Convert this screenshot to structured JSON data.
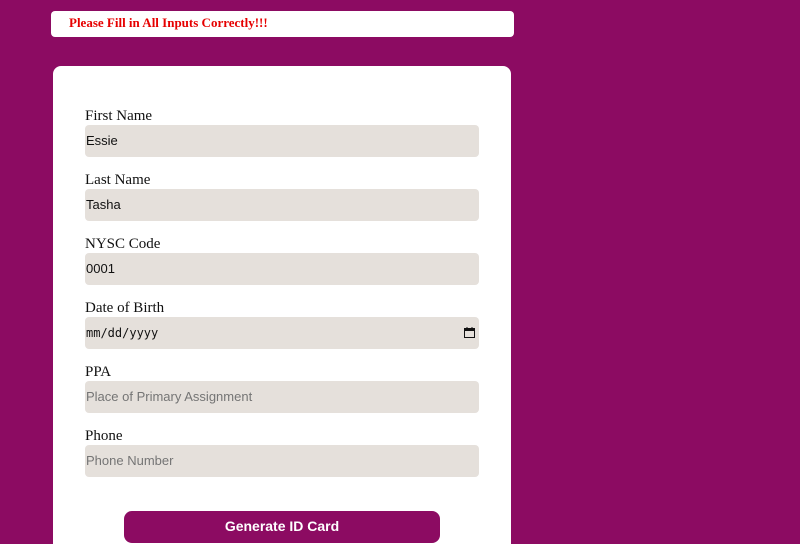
{
  "alert": {
    "message": "Please Fill in All Inputs Correctly!!!",
    "color": "#e60000"
  },
  "form": {
    "fields": [
      {
        "label": "First Name",
        "value": "Essie",
        "placeholder": ""
      },
      {
        "label": "Last Name",
        "value": "Tasha",
        "placeholder": ""
      },
      {
        "label": "NYSC Code",
        "value": "0001",
        "placeholder": ""
      },
      {
        "label": "Date of Birth",
        "value": "",
        "placeholder": "mm/dd/yyyy"
      },
      {
        "label": "PPA",
        "value": "",
        "placeholder": "Place of Primary Assignment"
      },
      {
        "label": "Phone",
        "value": "",
        "placeholder": "Phone Number"
      }
    ],
    "submit_label": "Generate ID Card"
  },
  "colors": {
    "background": "#8c0b62",
    "input_bg": "#e5e0db",
    "button_bg": "#8c0b62"
  },
  "icons": {
    "date_picker": "calendar-icon"
  }
}
